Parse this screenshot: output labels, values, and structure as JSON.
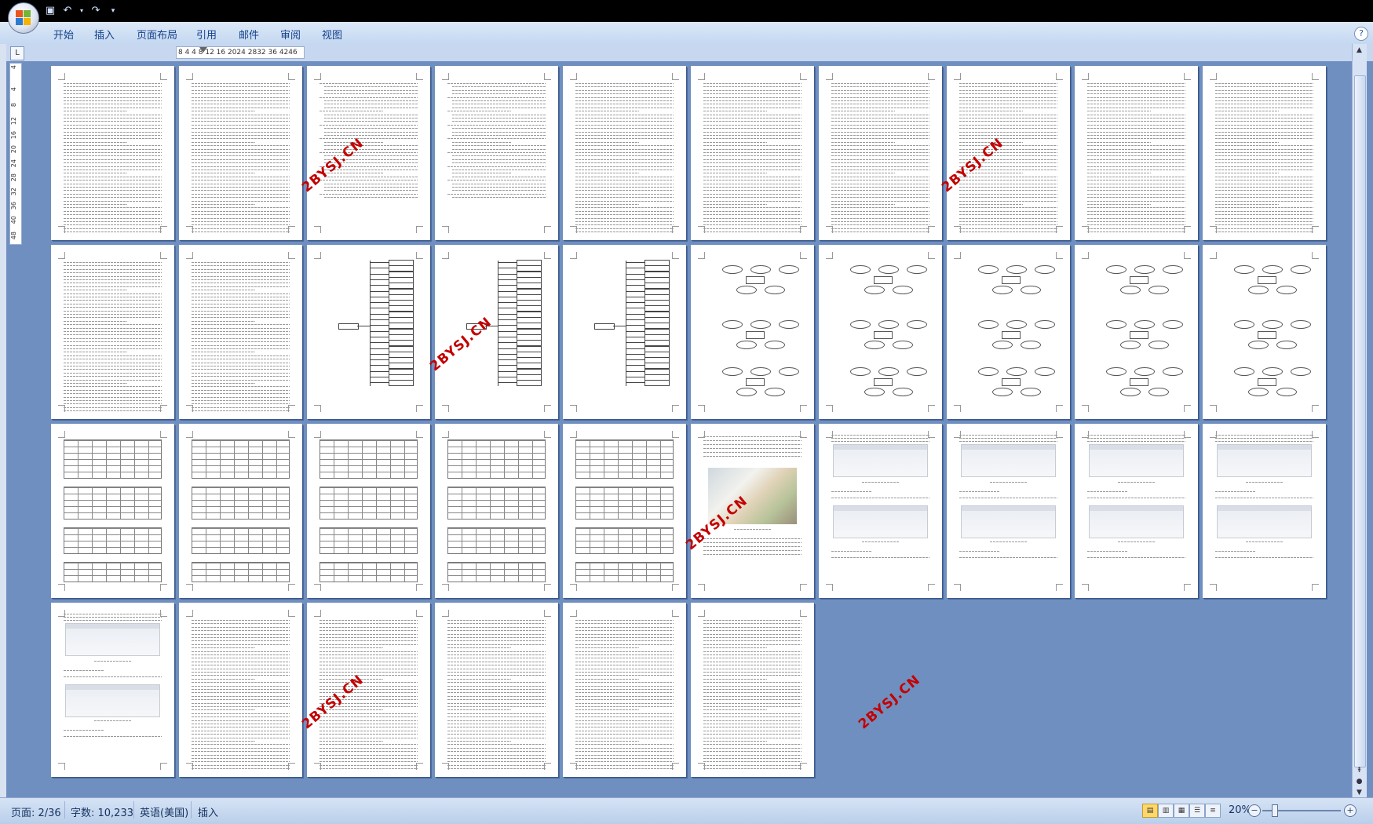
{
  "ribbon": {
    "tabs": [
      "开始",
      "插入",
      "页面布局",
      "引用",
      "邮件",
      "审阅",
      "视图"
    ]
  },
  "ruler": {
    "horizontal": "8  4    4  8 12 16 2024 2832 36  4246",
    "vertical": [
      "4",
      "4",
      "8",
      "12",
      "16",
      "20",
      "24",
      "28",
      "32",
      "36",
      "40",
      "48"
    ],
    "corner": "L"
  },
  "watermark": "2BYSJ.CN",
  "status": {
    "page": "页面: 2/36",
    "words": "字数: 10,233",
    "language": "英语(美国)",
    "mode": "插入",
    "zoom": "20%"
  },
  "icons": {
    "office": "office-button-icon",
    "save": "save-icon",
    "undo": "undo-icon",
    "redo": "redo-icon",
    "customize": "customize-qat-icon",
    "help": "help-icon",
    "zoom_out": "zoom-out-icon",
    "zoom_in": "zoom-in-icon"
  },
  "colors": {
    "workspace_bg": "#6f8fc0",
    "ribbon_text": "#15428b",
    "watermark": "#c40000"
  }
}
